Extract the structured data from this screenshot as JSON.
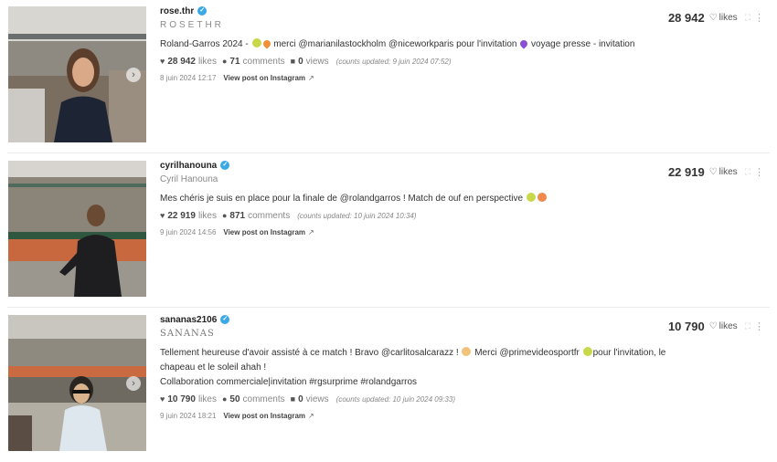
{
  "posts": [
    {
      "username": "rose.thr",
      "fullname": "ROSETHR",
      "caption_before": "Roland-Garros 2024 - ",
      "caption_after": " merci @marianilastockholm @niceworkparis pour l'invitation ",
      "caption_end": " voyage presse - invitation",
      "likes": "28 942",
      "likes_label": "likes",
      "comments": "71",
      "comments_label": "comments",
      "views": "0",
      "views_label": "views",
      "counts_prefix": "(counts updated: ",
      "counts_date": "9 juin 2024 07:52",
      "counts_suffix": ")",
      "date": "8 juin 2024 12:17",
      "view_link": "View post on Instagram",
      "total": "28 942",
      "total_label": "likes"
    },
    {
      "username": "cyrilhanouna",
      "fullname": "Cyril Hanouna",
      "caption": "Mes chéris je suis en place pour la finale de @rolandgarros ! Match de ouf en perspective ",
      "likes": "22 919",
      "likes_label": "likes",
      "comments": "871",
      "comments_label": "comments",
      "counts_prefix": "(counts updated: ",
      "counts_date": "10 juin 2024 10:34",
      "counts_suffix": ")",
      "date": "9 juin 2024 14:56",
      "view_link": "View post on Instagram",
      "total": "22 919",
      "total_label": "likes"
    },
    {
      "username": "sananas2106",
      "fullname": "SANANAS",
      "caption_line1a": "Tellement heureuse d'avoir assisté à ce match ! Bravo @carlitosalcarazz ! ",
      "caption_line1b": " Merci @primevideosportfr ",
      "caption_line1c": "pour l'invitation, le chapeau et le soleil ahah !",
      "caption_line2": "Collaboration commerciale|invitation #rgsurprime #rolandgarros",
      "likes": "10 790",
      "likes_label": "likes",
      "comments": "50",
      "comments_label": "comments",
      "views": "0",
      "views_label": "views",
      "counts_prefix": "(counts updated: ",
      "counts_date": "10 juin 2024 09:33",
      "counts_suffix": ")",
      "date": "9 juin 2024 18:21",
      "view_link": "View post on Instagram",
      "total": "10 790",
      "total_label": "likes"
    }
  ],
  "icons": {
    "verified": "check-badge-icon",
    "heart": "heart-icon",
    "comment": "comment-bubble-icon",
    "video": "video-camera-icon",
    "external": "external-link-icon",
    "expand": "expand-icon",
    "more": "more-vertical-icon",
    "carousel": "chevron-right-icon"
  },
  "colors": {
    "verified": "#3ba9e6",
    "text": "#333333",
    "muted": "#888888"
  }
}
